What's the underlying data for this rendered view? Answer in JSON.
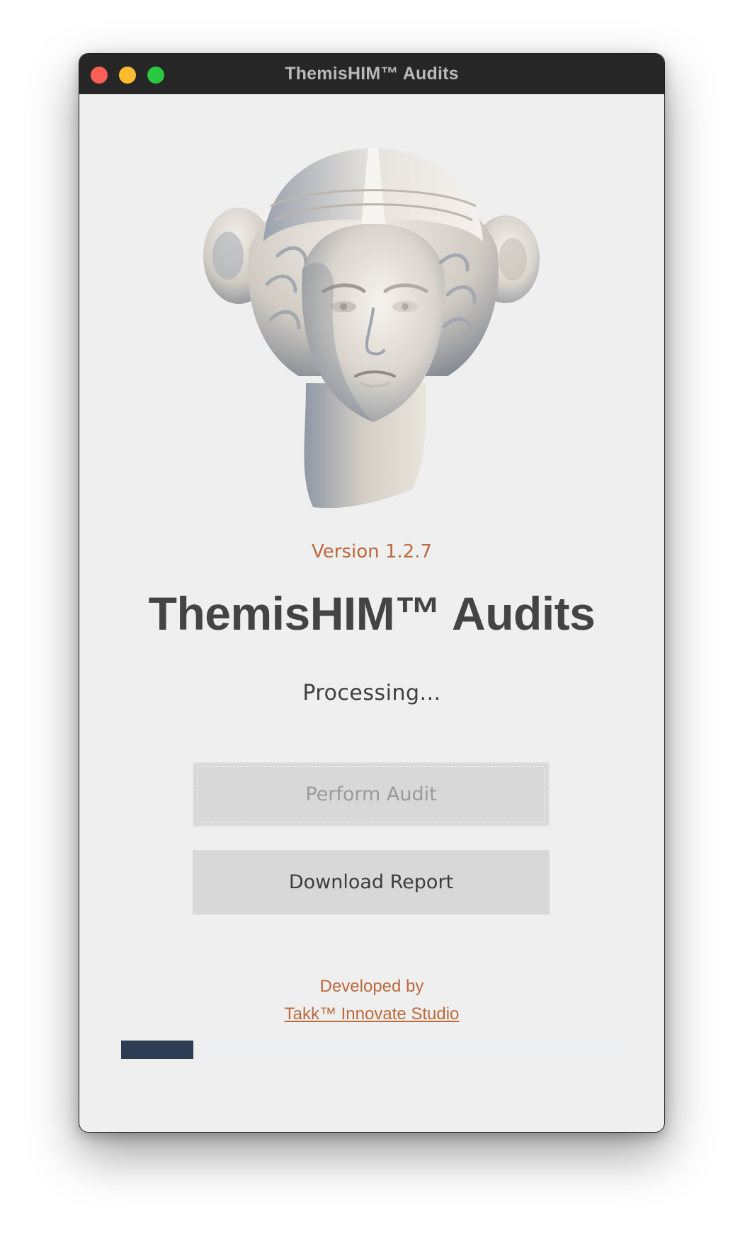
{
  "window": {
    "title": "ThemisHIM™ Audits"
  },
  "header": {
    "version": "Version 1.2.7",
    "app_title": "ThemisHIM™ Audits",
    "status": "Processing..."
  },
  "buttons": {
    "perform_audit": "Perform Audit",
    "download_report": "Download Report"
  },
  "footer": {
    "developed_by": "Developed by",
    "studio_link": "Takk™ Innovate Studio"
  },
  "progress": {
    "fraction": 0.145
  },
  "colors": {
    "accent": "#bb6a3c",
    "title_text": "#444444",
    "progress_fill": "#2d3c52",
    "button_bg": "#d8d8d8"
  },
  "icons": {
    "logo": "themis-bust-icon"
  }
}
